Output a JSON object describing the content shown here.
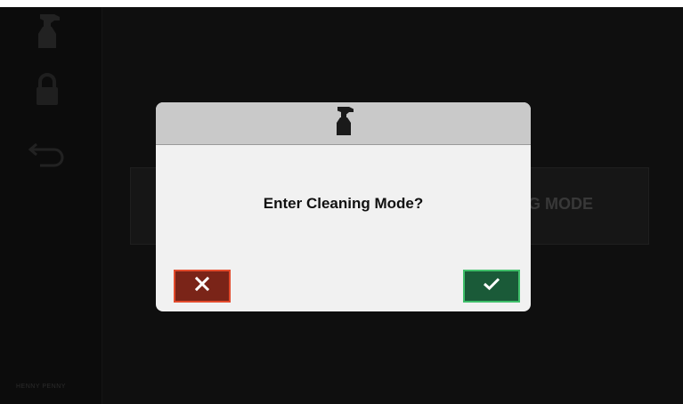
{
  "sidebar": {
    "items": [
      {
        "icon": "spray-bottle-icon"
      },
      {
        "icon": "lock-icon"
      },
      {
        "icon": "back-arrow-icon"
      }
    ],
    "brand": "HENNY PENNY"
  },
  "background_panel": {
    "label": "CLEANING MODE"
  },
  "dialog": {
    "header_icon": "spray-bottle-icon",
    "message": "Enter Cleaning Mode?",
    "cancel_icon": "close-icon",
    "confirm_icon": "checkmark-icon"
  },
  "colors": {
    "screen_bg": "#141414",
    "dialog_bg": "#f1f1f1",
    "dialog_header": "#c9c9c9",
    "cancel_bg": "#7a2418",
    "cancel_border": "#e24a2c",
    "confirm_bg": "#1a5a38",
    "confirm_border": "#3fbf6a"
  }
}
